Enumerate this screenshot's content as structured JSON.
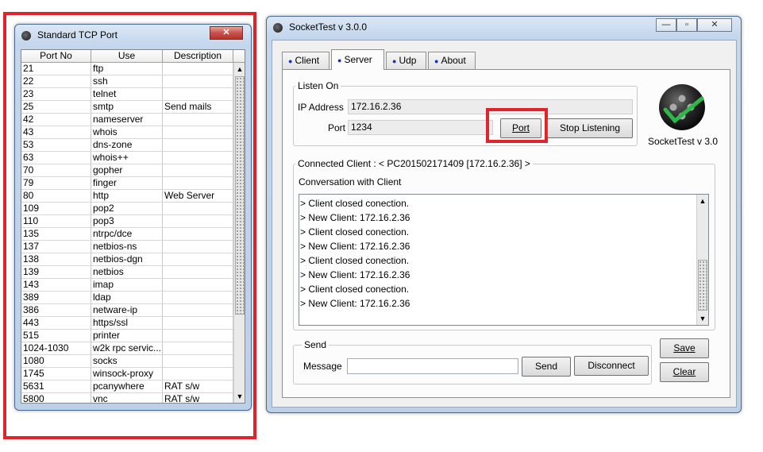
{
  "port_window": {
    "title": "Standard TCP Port",
    "columns": [
      "Port No",
      "Use",
      "Description"
    ],
    "rows": [
      [
        "21",
        "ftp",
        ""
      ],
      [
        "22",
        "ssh",
        ""
      ],
      [
        "23",
        "telnet",
        ""
      ],
      [
        "25",
        "smtp",
        "Send mails"
      ],
      [
        "42",
        "nameserver",
        ""
      ],
      [
        "43",
        "whois",
        ""
      ],
      [
        "53",
        "dns-zone",
        ""
      ],
      [
        "63",
        "whois++",
        ""
      ],
      [
        "70",
        "gopher",
        ""
      ],
      [
        "79",
        "finger",
        ""
      ],
      [
        "80",
        "http",
        "Web Server"
      ],
      [
        "109",
        "pop2",
        ""
      ],
      [
        "110",
        "pop3",
        ""
      ],
      [
        "135",
        "ntrpc/dce",
        ""
      ],
      [
        "137",
        "netbios-ns",
        ""
      ],
      [
        "138",
        "netbios-dgn",
        ""
      ],
      [
        "139",
        "netbios",
        ""
      ],
      [
        "143",
        "imap",
        ""
      ],
      [
        "389",
        "ldap",
        ""
      ],
      [
        "386",
        "netware-ip",
        ""
      ],
      [
        "443",
        "https/ssl",
        ""
      ],
      [
        "515",
        "printer",
        ""
      ],
      [
        "1024-1030",
        "w2k rpc servic...",
        ""
      ],
      [
        "1080",
        "socks",
        ""
      ],
      [
        "1745",
        "winsock-proxy",
        ""
      ],
      [
        "5631",
        "pcanywhere",
        "RAT s/w"
      ],
      [
        "5800",
        "vnc",
        "RAT s/w"
      ]
    ]
  },
  "socket_window": {
    "title": "SocketTest v 3.0.0",
    "tabs": [
      "Client",
      "Server",
      "Udp",
      "About"
    ],
    "active_tab": "Server",
    "listen_on": {
      "group_label": "Listen On",
      "ip_label": "IP Address",
      "ip_value": "172.16.2.36",
      "port_label": "Port",
      "port_value": "1234",
      "port_button": "Port",
      "stop_button": "Stop Listening"
    },
    "logo_caption": "SocketTest v 3.0",
    "connected": {
      "group_label": "Connected Client : <  PC201502171409 [172.16.2.36]  >",
      "conversation_label": "Conversation with Client",
      "log": [
        "> Client closed conection.",
        "> New Client: 172.16.2.36",
        "> Client closed conection.",
        "> New Client: 172.16.2.36",
        "> Client closed conection.",
        "> New Client: 172.16.2.36",
        "> Client closed conection.",
        "> New Client: 172.16.2.36"
      ]
    },
    "send": {
      "group_label": "Send",
      "message_label": "Message",
      "message_value": "",
      "send_button": "Send",
      "disconnect_button": "Disconnect"
    },
    "save_button": "Save",
    "clear_button": "Clear"
  },
  "caption_buttons": {
    "minimize": "—",
    "maximize": "▫",
    "close": "✕"
  },
  "colors": {
    "highlight_red": "#e0242b",
    "tab_dot": "#1a2fa8",
    "logo_check": "#2fb84a"
  }
}
